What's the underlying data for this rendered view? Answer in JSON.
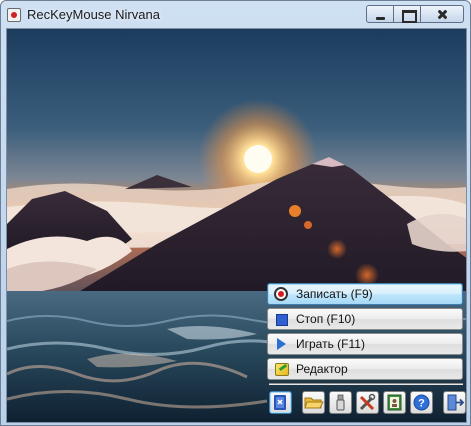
{
  "window": {
    "title": "RecKeyMouse Nirvana"
  },
  "actions": [
    {
      "label": "Записать  (F9)",
      "icon": "record-icon"
    },
    {
      "label": "Стоп  (F10)",
      "icon": "stop-icon"
    },
    {
      "label": "Играть  (F11)",
      "icon": "play-icon"
    },
    {
      "label": "Редактор",
      "icon": "editor-icon"
    }
  ],
  "toolbar": [
    {
      "icon": "help-book-icon"
    },
    {
      "icon": "open-folder-icon"
    },
    {
      "icon": "usb-drive-icon"
    },
    {
      "icon": "tools-icon"
    },
    {
      "icon": "info-card-icon"
    },
    {
      "icon": "question-icon"
    },
    {
      "icon": "exit-icon"
    }
  ],
  "colors": {
    "sky_top": "#1d3a5c",
    "sun": "#ffe4a0",
    "sea": "#0f2a3a"
  }
}
